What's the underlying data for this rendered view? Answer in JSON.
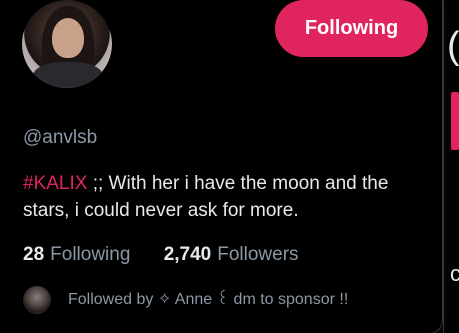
{
  "colors": {
    "background": "#000000",
    "accent": "#e0245e",
    "text_primary": "#e7e9ea",
    "text_secondary": "#8b98a5",
    "border": "#2f3336"
  },
  "profile": {
    "avatar_icon": "user-avatar",
    "display_name_emoji": "🐱",
    "handle": "@anvlsb",
    "follow_button_label": "Following",
    "bio": {
      "hashtag": "#KALIX",
      "text": " ;; With her i have the moon and the stars, i could never ask for more."
    },
    "stats": {
      "following_count": "28",
      "following_label": "Following",
      "followers_count": "2,740",
      "followers_label": "Followers"
    },
    "followed_by": {
      "avatar_icon": "follower-avatar",
      "text": "Followed by ✧ Anne ꒰ dm to sponsor !!"
    }
  },
  "background_page": {
    "glyph_top": "(",
    "glyph_bottom": "c"
  }
}
